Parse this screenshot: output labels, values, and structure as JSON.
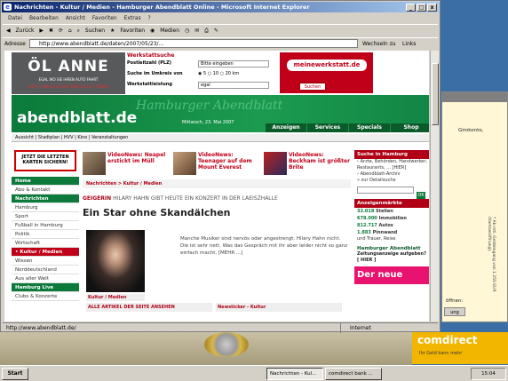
{
  "window": {
    "title": "Nachrichten - Kultur / Medien - Hamburger Abendblatt Online - Microsoft Internet Explorer",
    "controls": [
      "_",
      "□",
      "x"
    ]
  },
  "menu": [
    "Datei",
    "Bearbeiten",
    "Ansicht",
    "Favoriten",
    "Extras",
    "?"
  ],
  "toolbar": {
    "back": "Zurück",
    "search": "Suchen",
    "favorites": "Favoriten",
    "media": "Medien"
  },
  "address": {
    "label": "Adresse",
    "url": "http://www.abendblatt.de/daten/2007/05/23/...",
    "go": "Wechseln zu",
    "links": "Links"
  },
  "page": {
    "oel_ad": {
      "title": "ÖL ANNE",
      "line1": "EGAL WO SIE IHREN AUTO FAHRT",
      "line2": "NICHT LANGE SUCHEN, EINFACH GUT FINDEN"
    },
    "werkstatt": {
      "title": "Werkstattsuche",
      "plz_label": "Postleitzahl (PLZ)",
      "plz_placeholder": "Bitte eingeben",
      "radius_label": "Suche im Umkreis von",
      "radius_options": "◉ 5   ○ 10   ○ 20 km",
      "leistung_label": "Werkstattleistung",
      "leistung_value": "egal"
    },
    "meinewerkstatt": {
      "logo": "meinewerkstatt.de",
      "button": "Suchen"
    },
    "header": {
      "logo": "abendblatt.de",
      "masthead": "Hamburger Abendblatt",
      "date": "Mittwoch, 23. Mai 2007",
      "tabs": [
        "Anzeigen",
        "Services",
        "Specials",
        "Shop"
      ]
    },
    "subnav": "Aussicht | Stadtplan | HVV | Kino | Veranstaltungen",
    "left": {
      "ad": "JETZT DIE LETZTEN KARTEN SICHERN!",
      "nav": [
        {
          "label": "Home",
          "type": "sec"
        },
        {
          "label": "Abo & Kontakt",
          "type": ""
        },
        {
          "label": "Nachrichten",
          "type": "sec"
        },
        {
          "label": "Hamburg",
          "type": ""
        },
        {
          "label": "Sport",
          "type": ""
        },
        {
          "label": "Fußball in Hamburg",
          "type": ""
        },
        {
          "label": "Politik",
          "type": ""
        },
        {
          "label": "Wirtschaft",
          "type": ""
        },
        {
          "label": "• Kultur / Medien",
          "type": "act"
        },
        {
          "label": "Wissen",
          "type": ""
        },
        {
          "label": "Norddeutschland",
          "type": ""
        },
        {
          "label": "Aus aller Welt",
          "type": ""
        },
        {
          "label": "Hamburg Live",
          "type": "sec"
        },
        {
          "label": "Clubs & Konzerte",
          "type": ""
        }
      ]
    },
    "teasers": [
      "VideoNews: Neapel erstickt im Müll",
      "VideoNews: Teenager auf dem Mount Everest",
      "VideoNews: Beckham ist größter Brite"
    ],
    "breadcrumb": "Nachrichten > Kultur / Medien",
    "kicker_a": "GEIGERIN",
    "kicker_b": "HILARY HAHN GIBT HEUTE EIN KONZERT IN DER LAEISZHALLE",
    "headline": "Ein Star ohne Skandälchen",
    "body": "Manche Musiker sind nervös oder angestrengt. Hilary Hahn nicht. Die ist sehr nett. Was das Gespräch mit ihr aber leider nicht so ganz einfach macht. [MEHR ...]",
    "image_caption": "Kultur / Medien",
    "mini": [
      "ALLE ARTIKEL DER SEITE ANSEHEN",
      "Newsticker - Kultur"
    ],
    "right": {
      "search_title": "Suche in Hamburg",
      "search_items": [
        "› Ärzte, Behörden, Handwerker,",
        "Restaurants, ... [HIER]",
        "› Abendblatt-Archiv"
      ],
      "detail": "» zur Detailsuche",
      "ok": "OK",
      "markt_title": "Anzeigenmärkte",
      "markt": [
        {
          "n": "32.018",
          "t": "Stellen"
        },
        {
          "n": "678.000",
          "t": "Immobilien"
        },
        {
          "n": "812.717",
          "t": "Autos"
        },
        {
          "n": "1.883",
          "t": "Pinnwand"
        }
      ],
      "markt_more": "und Trauer, Reise",
      "ha_logo": "Hamburger Abendblatt",
      "zeitung": "Zeitungsanzeige aufgeben? [ HIER ]",
      "pink": "Der neue"
    }
  },
  "status": {
    "text": "http://www.abendblatt.de/",
    "zone": "Internet"
  },
  "bg_window": {
    "lines": [
      "Girokonto,"
    ],
    "vertical": "* Ab mtl. Geldeingang von 1.250 EUR (Kontoeröffnung).",
    "open": "öffnen:",
    "button": "ung"
  },
  "comdirect": {
    "logo": "comdirect",
    "tagline": "Ihr Geld kann mehr"
  },
  "taskbar": {
    "start": "Start",
    "tasks": [
      "Nachrichten - Kul...",
      "comdirect bank ..."
    ],
    "clock": "15:04"
  }
}
